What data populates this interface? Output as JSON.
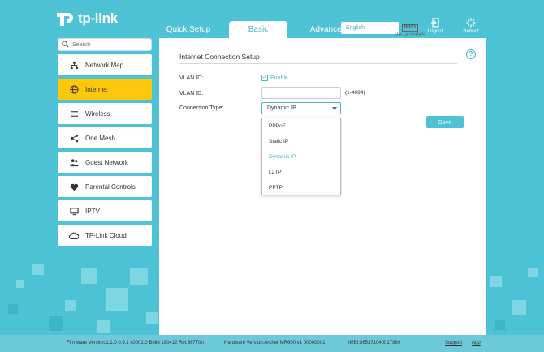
{
  "brand": {
    "name": "tp-link"
  },
  "tabs": [
    {
      "label": "Quick Setup",
      "active": false
    },
    {
      "label": "Basic",
      "active": true
    },
    {
      "label": "Advanced",
      "active": false
    }
  ],
  "language": {
    "selected": "English"
  },
  "watermark": {
    "text": "INFO",
    "line2": "تكنولوجيا بين يديك"
  },
  "header": {
    "logout_label": "Logout",
    "reboot_label": "Reboot"
  },
  "sidebar": {
    "search_placeholder": "Search",
    "items": [
      {
        "label": "Network Map",
        "icon": "network-map-icon",
        "active": false
      },
      {
        "label": "Internet",
        "icon": "globe-icon",
        "active": true
      },
      {
        "label": "Wireless",
        "icon": "wireless-icon",
        "active": false
      },
      {
        "label": "One Mesh",
        "icon": "mesh-icon",
        "active": false
      },
      {
        "label": "Guest Network",
        "icon": "guest-network-icon",
        "active": false
      },
      {
        "label": "Parental Controls",
        "icon": "parental-controls-icon",
        "active": false
      },
      {
        "label": "IPTV",
        "icon": "tv-icon",
        "active": false
      },
      {
        "label": "TP-Link Cloud",
        "icon": "cloud-icon",
        "active": false
      }
    ]
  },
  "main": {
    "section_title": "Internet Connection Setup",
    "vlan_enable_label": "VLAN ID:",
    "enable_text": "Enable",
    "vlan_id_label": "VLAN ID:",
    "vlan_id_value": "",
    "vlan_range": "(1-4094)",
    "connection_type_label": "Connection Type:",
    "connection_type_selected": "Dynamic IP",
    "options": [
      "PPPoE",
      "Static IP",
      "Dynamic IP",
      "L2TP",
      "PPTP"
    ],
    "save_label": "Save"
  },
  "footer": {
    "firmware": "Firmware Version:1.1.0 0.9.1 v0001.0 Build 190412 Rel.66770n",
    "hardware": "Hardware Version:Archer MR600 v1 00000001",
    "imei": "IMEI:865371040017989",
    "support": "Support",
    "app": "App"
  },
  "colors": {
    "accent": "#4ec3d6",
    "active": "#ffc70a",
    "text": "#333333"
  }
}
